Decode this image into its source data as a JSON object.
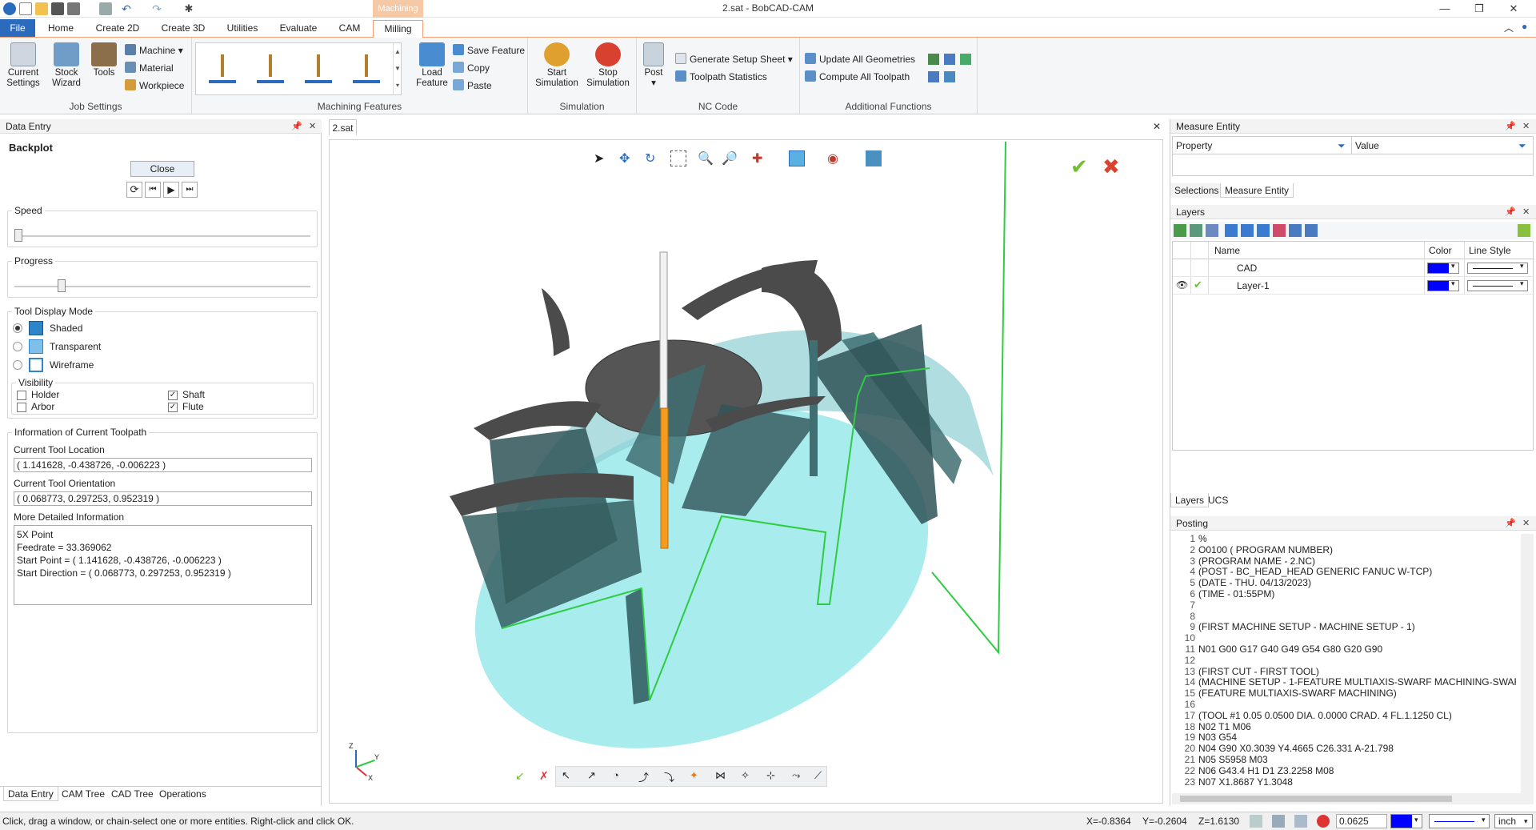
{
  "window": {
    "title": "2.sat - BobCAD-CAM"
  },
  "tabs": {
    "file": "File",
    "items": [
      "Home",
      "Create 2D",
      "Create 3D",
      "Utilities",
      "Evaluate",
      "CAM"
    ],
    "context_header": "Machining",
    "active": "Milling"
  },
  "ribbon": {
    "job_settings": {
      "label": "Job Settings",
      "current_settings": "Current Settings",
      "stock_wizard": "Stock Wizard",
      "tools": "Tools",
      "machine": "Machine",
      "material": "Material",
      "workpiece": "Workpiece"
    },
    "machining_features": {
      "label": "Machining Features",
      "load_feature": "Load Feature",
      "save_feature": "Save Feature",
      "copy": "Copy",
      "paste": "Paste"
    },
    "simulation": {
      "label": "Simulation",
      "start": "Start Simulation",
      "stop": "Stop Simulation"
    },
    "nc_code": {
      "label": "NC Code",
      "post": "Post",
      "generate_setup_sheet": "Generate Setup Sheet",
      "toolpath_statistics": "Toolpath Statistics"
    },
    "additional": {
      "label": "Additional Functions",
      "update_geometries": "Update All Geometries",
      "compute_toolpath": "Compute All Toolpath"
    }
  },
  "data_entry": {
    "title": "Data Entry",
    "heading": "Backplot",
    "close": "Close",
    "speed_label": "Speed",
    "progress_label": "Progress",
    "speed_value": 0.0,
    "progress_value": 0.15,
    "tool_display_mode": "Tool Display Mode",
    "modes": [
      "Shaded",
      "Transparent",
      "Wireframe"
    ],
    "selected_mode": "Shaded",
    "visibility": "Visibility",
    "holder": "Holder",
    "arbor": "Arbor",
    "shaft": "Shaft",
    "flute": "Flute",
    "holder_checked": false,
    "arbor_checked": false,
    "shaft_checked": true,
    "flute_checked": true,
    "info_heading": "Information of Current Toolpath",
    "loc_label": "Current Tool Location",
    "loc_value": "( 1.141628, -0.438726, -0.006223 )",
    "orient_label": "Current Tool Orientation",
    "orient_value": "( 0.068773, 0.297253, 0.952319 )",
    "detail_label": "More Detailed Information",
    "detail_lines": [
      "5X Point",
      "Feedrate = 33.369062",
      "Start Point = ( 1.141628, -0.438726, -0.006223 )",
      "Start Direction = ( 0.068773, 0.297253, 0.952319 )"
    ],
    "bottom_tabs": [
      "Data Entry",
      "CAM Tree",
      "CAD Tree",
      "Operations"
    ]
  },
  "viewport": {
    "tab": "2.sat",
    "axis_y": "Y",
    "axis_x": "X",
    "axis_z": "Z"
  },
  "measure": {
    "title": "Measure Entity",
    "col_property": "Property",
    "col_value": "Value",
    "tabs": [
      "Selections",
      "Measure Entity"
    ]
  },
  "layers": {
    "title": "Layers",
    "col_name": "Name",
    "col_color": "Color",
    "col_style": "Line Style",
    "rows": [
      {
        "name": "CAD",
        "color": "#0000ff"
      },
      {
        "name": "Layer-1",
        "color": "#0000ff"
      }
    ],
    "tabs": [
      "Layers",
      "UCS"
    ]
  },
  "posting": {
    "title": "Posting",
    "lines": [
      "%",
      "O0100 ( PROGRAM NUMBER)",
      "(PROGRAM NAME - 2.NC)",
      "(POST -  BC_HEAD_HEAD GENERIC FANUC W-TCP)",
      "(DATE - THU. 04/13/2023)",
      "(TIME - 01:55PM)",
      "",
      "",
      "(FIRST MACHINE SETUP - MACHINE SETUP - 1)",
      "",
      "N01 G00 G17 G40 G49 G54 G80 G20 G90",
      "",
      "(FIRST CUT - FIRST TOOL)",
      "(MACHINE SETUP - 1-FEATURE MULTIAXIS-SWARF MACHINING-SWAR",
      "(FEATURE MULTIAXIS-SWARF MACHINING)",
      "",
      "(TOOL #1 0.05 0.0500 DIA. 0.0000 CRAD. 4 FL.1.1250 CL)",
      "N02 T1 M06",
      "N03 G54",
      "N04 G90 X0.3039 Y4.4665 C26.331 A-21.798",
      "N05 S5958 M03",
      "N06 G43.4 H1 D1 Z3.2258 M08",
      "N07 X1.8687 Y1.3048"
    ]
  },
  "status": {
    "message": "Click, drag a window, or chain-select one or more entities. Right-click and click OK.",
    "x": "X=-0.8364",
    "y": "Y=-0.2604",
    "z": "Z=1.6130",
    "step": "0.0625",
    "units": "inch"
  }
}
